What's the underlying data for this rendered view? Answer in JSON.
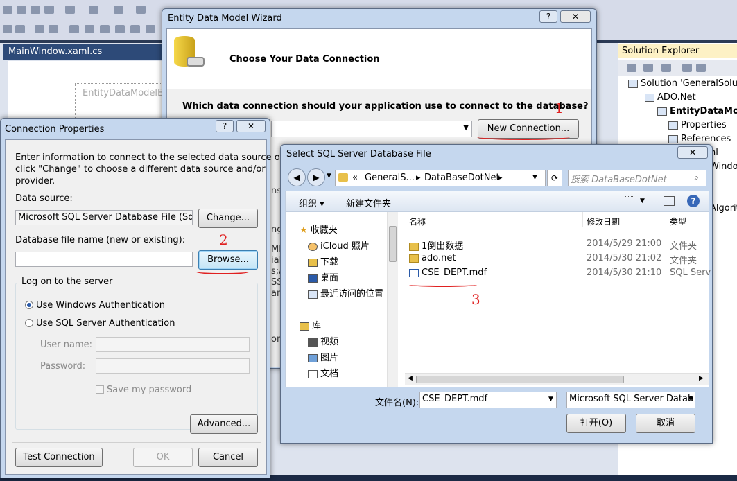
{
  "ide": {
    "doc_tab": "MainWindow.xaml.cs",
    "designer_label": "EntityDataModelExa",
    "solution_explorer": {
      "title": "Solution Explorer",
      "items": [
        "Solution 'GeneralSolutio",
        "ADO.Net",
        "EntityDataMode",
        "Properties",
        "References",
        "nl",
        "Window.",
        "Algorit"
      ]
    }
  },
  "wizard": {
    "title": "Entity Data Model Wizard",
    "help": "?",
    "close": "✕",
    "heading": "Choose Your Data Connection",
    "question": "Which data connection should your application use to connect to the database?",
    "new_connection": "New Connection...",
    "partial_labels": [
      "ns",
      "ng:",
      "MM",
      "ial:p",
      "s;A",
      "SS",
      "an",
      "or"
    ]
  },
  "conn": {
    "title": "Connection Properties",
    "help": "?",
    "close": "✕",
    "intro_line1": "Enter information to connect to the selected data source or",
    "intro_line2": "click \"Change\" to choose a different data source and/or",
    "intro_line3": "provider.",
    "data_source_label": "Data source:",
    "data_source_value": "Microsoft SQL Server Database File (SqlClie",
    "change": "Change...",
    "db_file_label": "Database file name (new or existing):",
    "db_file_value": "",
    "browse": "Browse...",
    "logon_group": "Log on to the server",
    "win_auth": "Use Windows Authentication",
    "sql_auth": "Use SQL Server Authentication",
    "user_label": "User name:",
    "pass_label": "Password:",
    "save_pw": "Save my password",
    "advanced": "Advanced...",
    "test": "Test Connection",
    "ok": "OK",
    "cancel": "Cancel"
  },
  "filedlg": {
    "title": "Select SQL Server Database File",
    "close": "✕",
    "path": [
      "«",
      "GeneralS...",
      "DataBaseDotNet"
    ],
    "search_placeholder": "搜索 DataBaseDotNet",
    "organize": "组织 ▾",
    "new_folder": "新建文件夹",
    "nav": {
      "favorites": "收藏夹",
      "fav_items": [
        "iCloud 照片",
        "下载",
        "桌面",
        "最近访问的位置"
      ],
      "libraries": "库",
      "lib_items": [
        "视频",
        "图片",
        "文档"
      ]
    },
    "columns": [
      "名称",
      "修改日期",
      "类型"
    ],
    "files": [
      {
        "name": "1倒出数据",
        "date": "2014/5/29 21:00",
        "type": "文件夹"
      },
      {
        "name": "ado.net",
        "date": "2014/5/30 21:02",
        "type": "文件夹"
      },
      {
        "name": "CSE_DEPT.mdf",
        "date": "2014/5/30 21:10",
        "type": "SQL Serv"
      }
    ],
    "filename_label": "文件名(N):",
    "filename_value": "CSE_DEPT.mdf",
    "filter_value": "Microsoft SQL Server Datab",
    "open": "打开(O)",
    "cancel": "取消"
  },
  "annotations": [
    "1",
    "2",
    "3"
  ]
}
